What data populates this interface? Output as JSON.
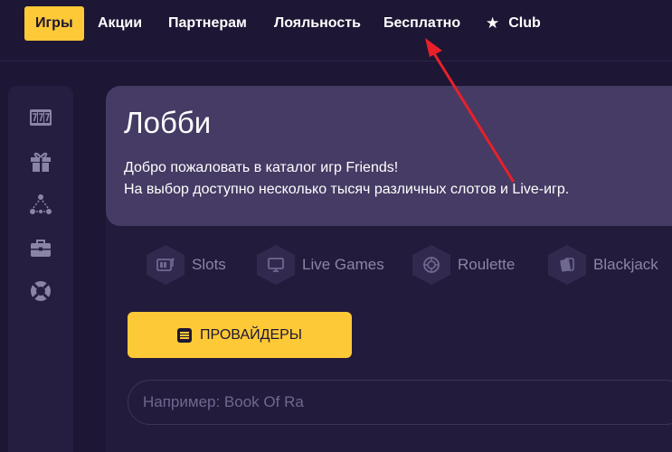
{
  "nav": {
    "items": [
      {
        "label": "Игры",
        "active": true
      },
      {
        "label": "Акции"
      },
      {
        "label": "Партнерам"
      },
      {
        "label": "Лояльность"
      },
      {
        "label": "Бесплатно"
      },
      {
        "label": "Club",
        "icon": "star-icon"
      }
    ]
  },
  "sidebar": {
    "icons": [
      "slot-777-icon",
      "gift-icon",
      "network-icon",
      "briefcase-icon",
      "lifebuoy-icon"
    ]
  },
  "lobby": {
    "title": "Лобби",
    "line1": "Добро пожаловать в каталог игр Friends!",
    "line2": "На выбор доступно несколько тысяч различных слотов и Live-игр."
  },
  "categories": [
    {
      "label": "Slots",
      "icon": "slot-machine-icon"
    },
    {
      "label": "Live Games",
      "icon": "monitor-icon"
    },
    {
      "label": "Roulette",
      "icon": "roulette-icon"
    },
    {
      "label": "Blackjack",
      "icon": "cards-icon"
    }
  ],
  "providers_button": {
    "label": "ПРОВАЙДЕРЫ"
  },
  "search": {
    "placeholder": "Например: Book Of Ra",
    "value": ""
  },
  "colors": {
    "accent": "#fdc936",
    "background": "#1d1634",
    "banner": "#463b64",
    "annotation": "#e8202a"
  }
}
